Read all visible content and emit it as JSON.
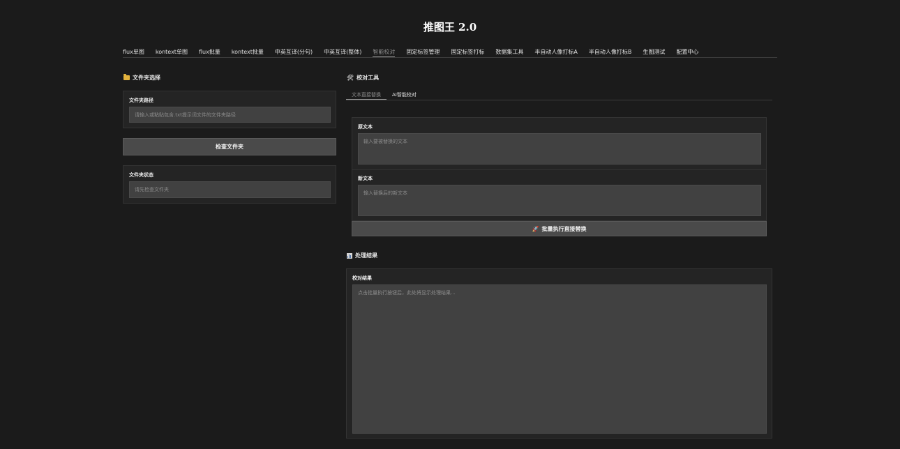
{
  "app": {
    "title": "推图王 2.0"
  },
  "nav": {
    "tabs": [
      {
        "label": "flux单图"
      },
      {
        "label": "kontext单图"
      },
      {
        "label": "flux批量"
      },
      {
        "label": "kontext批量"
      },
      {
        "label": "中英互译(分句)"
      },
      {
        "label": "中英互译(整体)"
      },
      {
        "label": "智能校对",
        "active": true
      },
      {
        "label": "固定标签管理"
      },
      {
        "label": "固定标签打标"
      },
      {
        "label": "数据集工具"
      },
      {
        "label": "半自动人像打标A"
      },
      {
        "label": "半自动人像打标B"
      },
      {
        "label": "生图测试"
      },
      {
        "label": "配置中心"
      }
    ]
  },
  "left": {
    "section_title": "文件夹选择",
    "folder_path": {
      "label": "文件夹路径",
      "placeholder": "请输入或粘贴包含.txt提示词文件的文件夹路径",
      "value": ""
    },
    "check_button": "检查文件夹",
    "folder_status": {
      "label": "文件夹状态",
      "placeholder": "请先检查文件夹",
      "value": ""
    }
  },
  "right": {
    "section_title": "校对工具",
    "subtabs": [
      {
        "label": "文本直接替换",
        "active": true
      },
      {
        "label": "AI智能校对"
      }
    ],
    "original_text": {
      "label": "原文本",
      "placeholder": "输入要被替换的文本",
      "value": ""
    },
    "new_text": {
      "label": "新文本",
      "placeholder": "输入替换后的新文本",
      "value": ""
    },
    "run_button": "批量执行直接替换",
    "results_title": "处理结果",
    "result": {
      "label": "校对结果",
      "placeholder": "点击批量执行按钮后，此处将显示处理结果...",
      "value": ""
    }
  },
  "icons": {
    "folder": "folder-icon",
    "tools": "wrench-icon",
    "rocket": "rocket-icon",
    "results": "bar-chart-icon"
  },
  "colors": {
    "background": "#1b1b1b",
    "panel": "#242424",
    "field": "#414141",
    "button": "#4a4a4a",
    "folder_icon": "#e4b33d"
  }
}
